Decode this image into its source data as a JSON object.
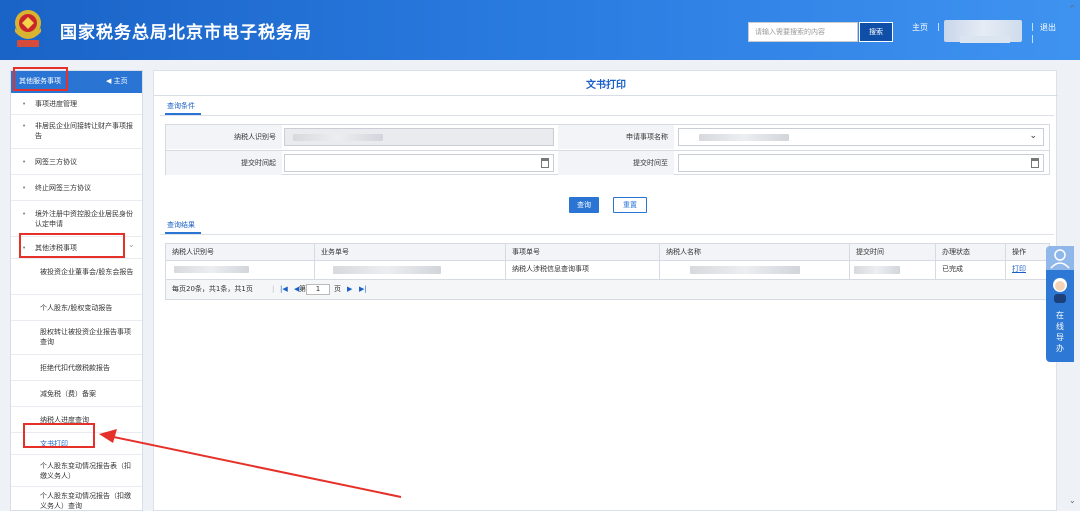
{
  "header": {
    "site_title": "国家税务总局北京市电子税务局",
    "search_placeholder": "请输入需要搜索的内容",
    "search_button": "搜索",
    "home_link": "主页",
    "separator": "|",
    "logout": "退出"
  },
  "sidebar": {
    "header_title": "其他服务事项",
    "home_link": "主页",
    "items": [
      {
        "label": "事项进度管理"
      },
      {
        "label": "非居民企业间接转让财产事项报告"
      },
      {
        "label": "网签三方协议"
      },
      {
        "label": "终止网签三方协议"
      },
      {
        "label": "境外注册中资控股企业居民身份认定申请"
      },
      {
        "label": "其他涉税事项"
      }
    ],
    "subitems": [
      {
        "label": "被投资企业董事会/股东会报告"
      },
      {
        "label": "个人股东/股权变动报告"
      },
      {
        "label": "股权转让被投资企业报告事项查询"
      },
      {
        "label": "拒绝代扣代缴税款报告"
      },
      {
        "label": "减免税（费）备案"
      },
      {
        "label": "纳税人进度查询"
      },
      {
        "label": "文书打印"
      },
      {
        "label": "个人股东变动情况报告表（扣缴义务人）"
      },
      {
        "label": "个人股东变动情况报告（扣缴义务人）查询"
      }
    ]
  },
  "main": {
    "title": "文书打印",
    "query_tab": "查询条件",
    "result_tab": "查询结果",
    "form": {
      "taxpayer_id_label": "纳税人识别号",
      "matter_name_label": "申请事项名称",
      "submit_from_label": "提交时间起",
      "submit_to_label": "提交时间至"
    },
    "query_button": "查询",
    "reset_button": "重置",
    "table": {
      "headers": [
        "纳税人识别号",
        "业务单号",
        "事项单号",
        "纳税人名称",
        "提交时间",
        "办理状态",
        "操作"
      ],
      "rows": [
        {
          "matter": "纳税人涉税信息查询事项",
          "status": "已完成",
          "action": "打印"
        }
      ]
    },
    "pager": {
      "info": "每页20条，共1条，共1页",
      "page_prefix": "第",
      "page_value": "1",
      "page_suffix": "页"
    }
  },
  "float_widget": {
    "label": "在线导办"
  }
}
